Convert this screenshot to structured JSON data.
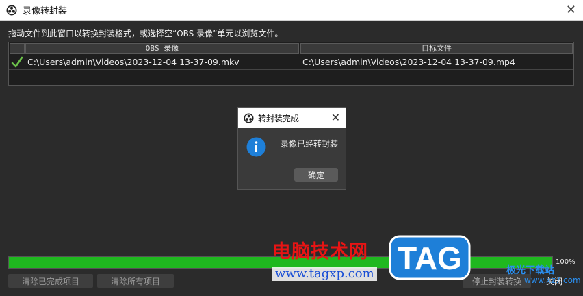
{
  "window": {
    "title": "录像转封装"
  },
  "instruction": "拖动文件到此窗口以转换封装格式，或选择空“OBS 录像”单元以浏览文件。",
  "table": {
    "columns": [
      "OBS 录像",
      "目标文件"
    ],
    "rows": [
      {
        "status": "done",
        "source": "C:\\Users\\admin\\Videos\\2023-12-04 13-37-09.mkv",
        "target": "C:\\Users\\admin\\Videos\\2023-12-04 13-37-09.mp4"
      }
    ]
  },
  "dialog": {
    "title": "转封装完成",
    "message": "录像已经转封装",
    "ok_label": "确定",
    "icon": "info-icon"
  },
  "progress": {
    "value": 100,
    "label": "100%"
  },
  "buttons": {
    "clear_done": "清除已完成项目",
    "clear_all": "清除所有项目",
    "stop": "停止封装转换",
    "close": "关闭"
  },
  "watermark": {
    "text": "电脑技术网",
    "url": "www.tagxp.com",
    "logo": "TAG",
    "site": "极光下载站",
    "site_url": "www.xz7.com"
  },
  "colors": {
    "progress": "#1fb81f",
    "info": "#1e7fd8",
    "check": "#6cc24a"
  }
}
